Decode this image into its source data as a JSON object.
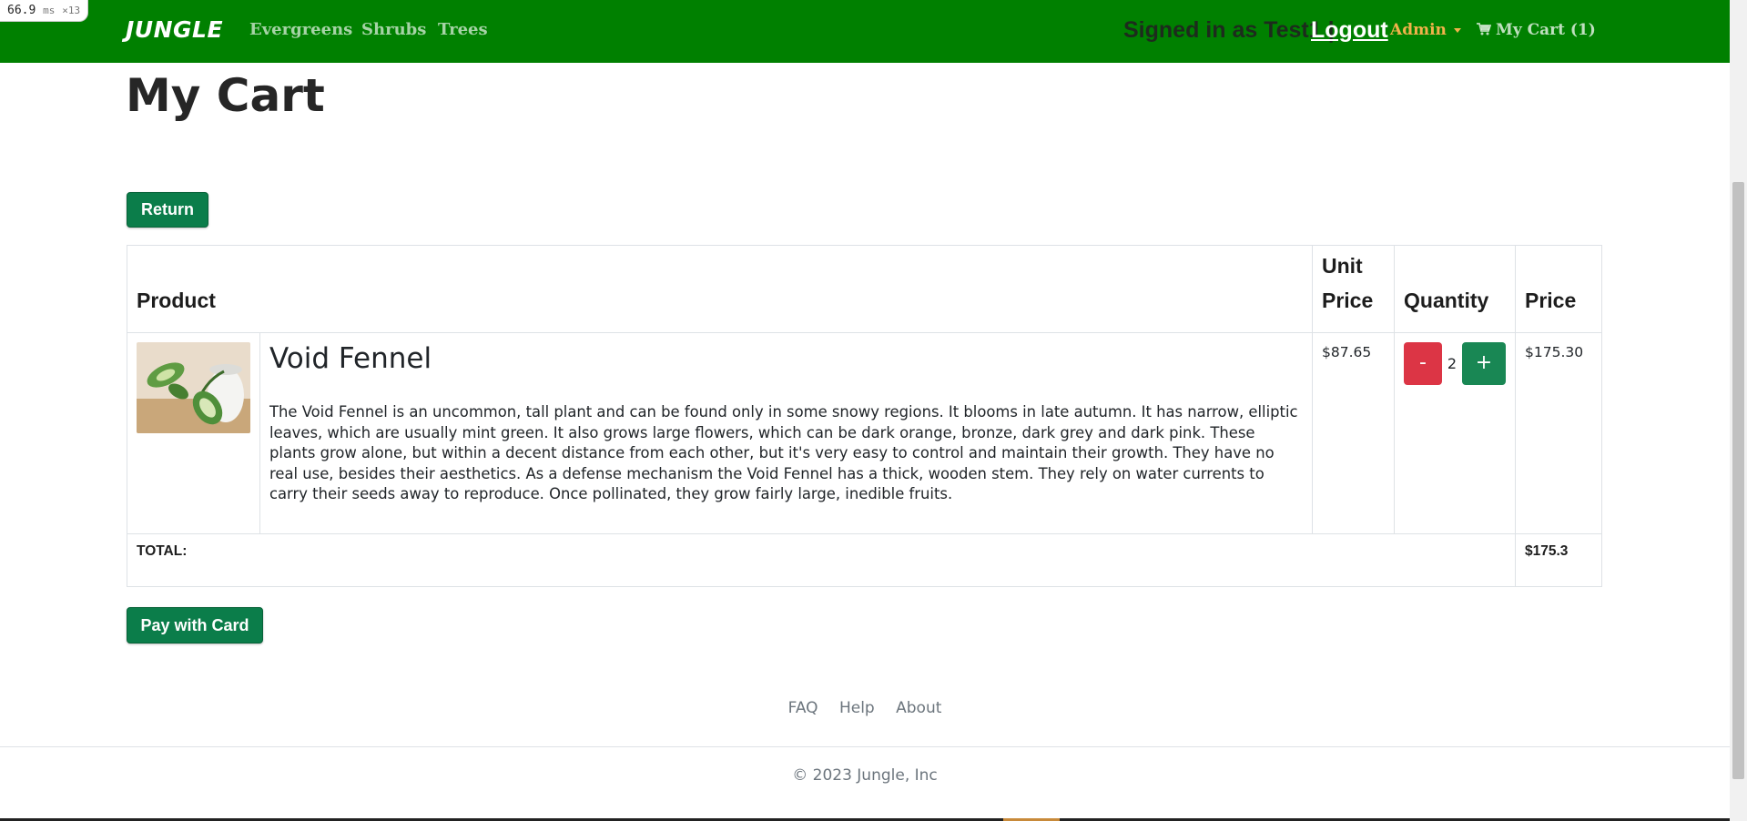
{
  "perf": {
    "value": "66.9",
    "unit": "ms",
    "count": "×13"
  },
  "nav": {
    "brand": "JUNGLE",
    "links": [
      "Evergreens",
      "Shrubs",
      "Trees"
    ],
    "signed_in": "Signed in as Test1 |",
    "logout": "Logout",
    "admin": "Admin",
    "cart": "My Cart (1)"
  },
  "page": {
    "title": "My Cart"
  },
  "buttons": {
    "return": "Return",
    "pay": "Pay with Card"
  },
  "table": {
    "headers": {
      "product": "Product",
      "unit_price": "Unit Price",
      "quantity": "Quantity",
      "price": "Price"
    },
    "items": [
      {
        "name": "Void Fennel",
        "description": "The Void Fennel is an uncommon, tall plant and can be found only in some snowy regions. It blooms in late autumn. It has narrow, elliptic leaves, which are usually mint green. It also grows large flowers, which can be dark orange, bronze, dark grey and dark pink. These plants grow alone, but within a decent distance from each other, but it's very easy to control and maintain their growth. They have no real use, besides their aesthetics. As a defense mechanism the Void Fennel has a thick, wooden stem. They rely on water currents to carry their seeds away to reproduce. Once pollinated, they grow fairly large, inedible fruits.",
        "unit_price": "$87.65",
        "quantity": "2",
        "minus": "-",
        "plus": "+",
        "price": "$175.30"
      }
    ],
    "total_label": "TOTAL:",
    "total_value": "$175.3"
  },
  "footer": {
    "links": [
      "FAQ",
      "Help",
      "About"
    ],
    "copyright": "© 2023 Jungle, Inc"
  },
  "colors": {
    "navbar": "#008000",
    "button": "#0b7d4a",
    "minus": "#dc3545",
    "plus": "#198754",
    "admin": "#f2b24b"
  }
}
